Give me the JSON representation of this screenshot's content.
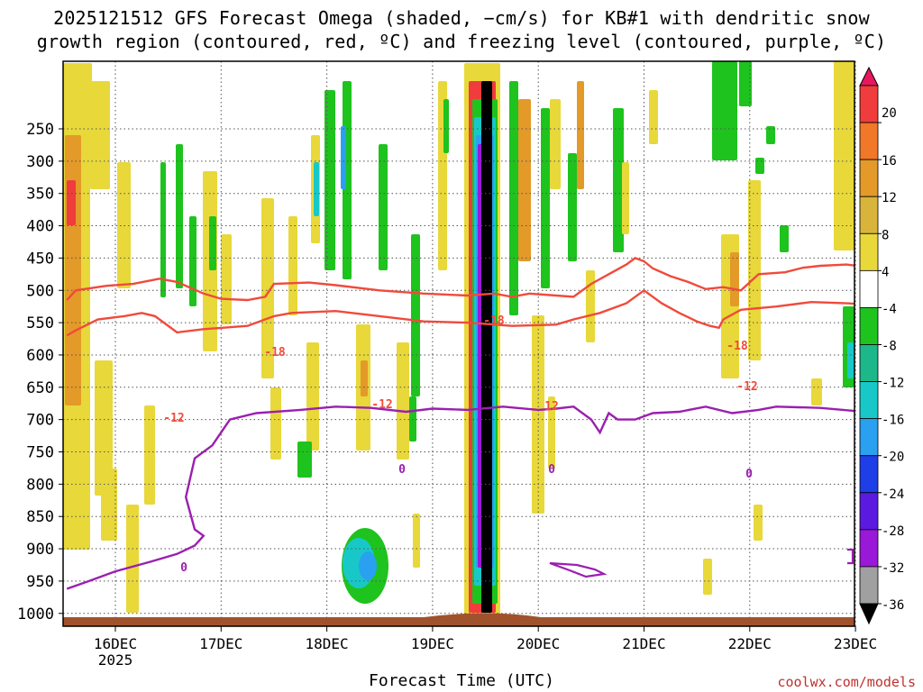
{
  "title_line1": "2025121512 GFS Forecast Omega (shaded, −cm/s) for KB#1 with dendritic snow",
  "title_line2": "growth region (contoured, red, ºC) and freezing level (contoured, purple, ºC)",
  "credit": "coolwx.com/models",
  "colors": {
    "dgz_contour": "#f04a3c",
    "freezing_contour": "#9b1fb0",
    "ground": "#a0522d"
  },
  "chart_data": {
    "type": "heatmap",
    "xlabel": "Forecast Time (UTC)",
    "ylabel": "",
    "x_ticks": [
      "16DEC",
      "17DEC",
      "18DEC",
      "19DEC",
      "20DEC",
      "21DEC",
      "22DEC",
      "23DEC"
    ],
    "x_year_label": "2025",
    "x_range_hours": [
      -11,
      180
    ],
    "y_ticks": [
      "250",
      "300",
      "350",
      "400",
      "450",
      "500",
      "550",
      "600",
      "650",
      "700",
      "750",
      "800",
      "850",
      "900",
      "950",
      "1000"
    ],
    "y_range_hpa": [
      200,
      1000
    ],
    "y_scale": "pressure",
    "colorbar": {
      "labels": [
        "20",
        "16",
        "12",
        "8",
        "4",
        "-4",
        "-8",
        "-12",
        "-16",
        "-20",
        "-24",
        "-28",
        "-32",
        "-36"
      ],
      "colors": [
        "#e8175d",
        "#f03c3c",
        "#f07828",
        "#e39a28",
        "#d8b53a",
        "#e8d83a",
        "#ffffff",
        "#1ec31e",
        "#1cb88a",
        "#18c8c8",
        "#2aa0f0",
        "#1e3ee8",
        "#5a1ae0",
        "#9a18d8",
        "#a0a0a0",
        "#000000"
      ]
    },
    "contour_labels": [
      {
        "text": "-18"
      },
      {
        "text": "-18"
      },
      {
        "text": "-18"
      },
      {
        "text": "-12"
      },
      {
        "text": "-12"
      },
      {
        "text": "12"
      },
      {
        "text": "-12"
      },
      {
        "text": "0"
      },
      {
        "text": "0"
      },
      {
        "text": "0"
      },
      {
        "text": "0"
      }
    ],
    "dgz_minus18": [
      [
        -11,
        515
      ],
      [
        -9,
        500
      ],
      [
        -2,
        493
      ],
      [
        4,
        490
      ],
      [
        10,
        482
      ],
      [
        14,
        487
      ],
      [
        20,
        505
      ],
      [
        24,
        513
      ],
      [
        30,
        515
      ],
      [
        34,
        510
      ],
      [
        36,
        490
      ],
      [
        44,
        488
      ],
      [
        50,
        492
      ],
      [
        60,
        500
      ],
      [
        70,
        505
      ],
      [
        80,
        508
      ],
      [
        86,
        505
      ],
      [
        90,
        510
      ],
      [
        94,
        505
      ],
      [
        104,
        510
      ],
      [
        108,
        490
      ],
      [
        112,
        475
      ],
      [
        116,
        460
      ],
      [
        118,
        450
      ],
      [
        120,
        455
      ],
      [
        122,
        466
      ],
      [
        126,
        478
      ],
      [
        130,
        487
      ],
      [
        134,
        498
      ],
      [
        138,
        495
      ],
      [
        142,
        500
      ],
      [
        146,
        475
      ],
      [
        152,
        472
      ],
      [
        156,
        465
      ],
      [
        160,
        462
      ],
      [
        166,
        460
      ],
      [
        172,
        465
      ],
      [
        178,
        470
      ],
      [
        180,
        478
      ]
    ],
    "dgz_minus12": [
      [
        -11,
        570
      ],
      [
        -9,
        562
      ],
      [
        -4,
        545
      ],
      [
        2,
        540
      ],
      [
        6,
        535
      ],
      [
        9,
        540
      ],
      [
        14,
        565
      ],
      [
        20,
        560
      ],
      [
        30,
        555
      ],
      [
        36,
        540
      ],
      [
        40,
        535
      ],
      [
        50,
        532
      ],
      [
        60,
        540
      ],
      [
        70,
        548
      ],
      [
        80,
        550
      ],
      [
        90,
        555
      ],
      [
        100,
        553
      ],
      [
        104,
        545
      ],
      [
        110,
        535
      ],
      [
        116,
        520
      ],
      [
        120,
        500
      ],
      [
        124,
        520
      ],
      [
        128,
        535
      ],
      [
        132,
        548
      ],
      [
        135,
        555
      ],
      [
        137,
        558
      ],
      [
        138,
        545
      ],
      [
        142,
        530
      ],
      [
        150,
        525
      ],
      [
        158,
        518
      ],
      [
        166,
        520
      ],
      [
        172,
        522
      ],
      [
        176,
        530
      ],
      [
        178,
        535
      ],
      [
        180,
        535
      ]
    ],
    "freezing_0": [
      [
        -11,
        962
      ],
      [
        -6,
        950
      ],
      [
        0,
        935
      ],
      [
        8,
        920
      ],
      [
        14,
        908
      ],
      [
        18,
        895
      ],
      [
        20,
        880
      ],
      [
        18,
        870
      ],
      [
        16,
        820
      ],
      [
        18,
        760
      ],
      [
        22,
        740
      ],
      [
        26,
        700
      ],
      [
        32,
        690
      ],
      [
        42,
        685
      ],
      [
        50,
        680
      ],
      [
        58,
        682
      ],
      [
        66,
        688
      ],
      [
        72,
        683
      ],
      [
        80,
        685
      ],
      [
        88,
        680
      ],
      [
        96,
        685
      ],
      [
        100,
        683
      ],
      [
        104,
        680
      ],
      [
        108,
        700
      ],
      [
        110,
        720
      ],
      [
        112,
        690
      ],
      [
        114,
        700
      ],
      [
        118,
        700
      ],
      [
        122,
        690
      ],
      [
        128,
        688
      ],
      [
        134,
        680
      ],
      [
        140,
        690
      ],
      [
        146,
        685
      ],
      [
        150,
        680
      ],
      [
        160,
        682
      ],
      [
        170,
        688
      ],
      [
        176,
        700
      ],
      [
        180,
        750
      ]
    ]
  }
}
